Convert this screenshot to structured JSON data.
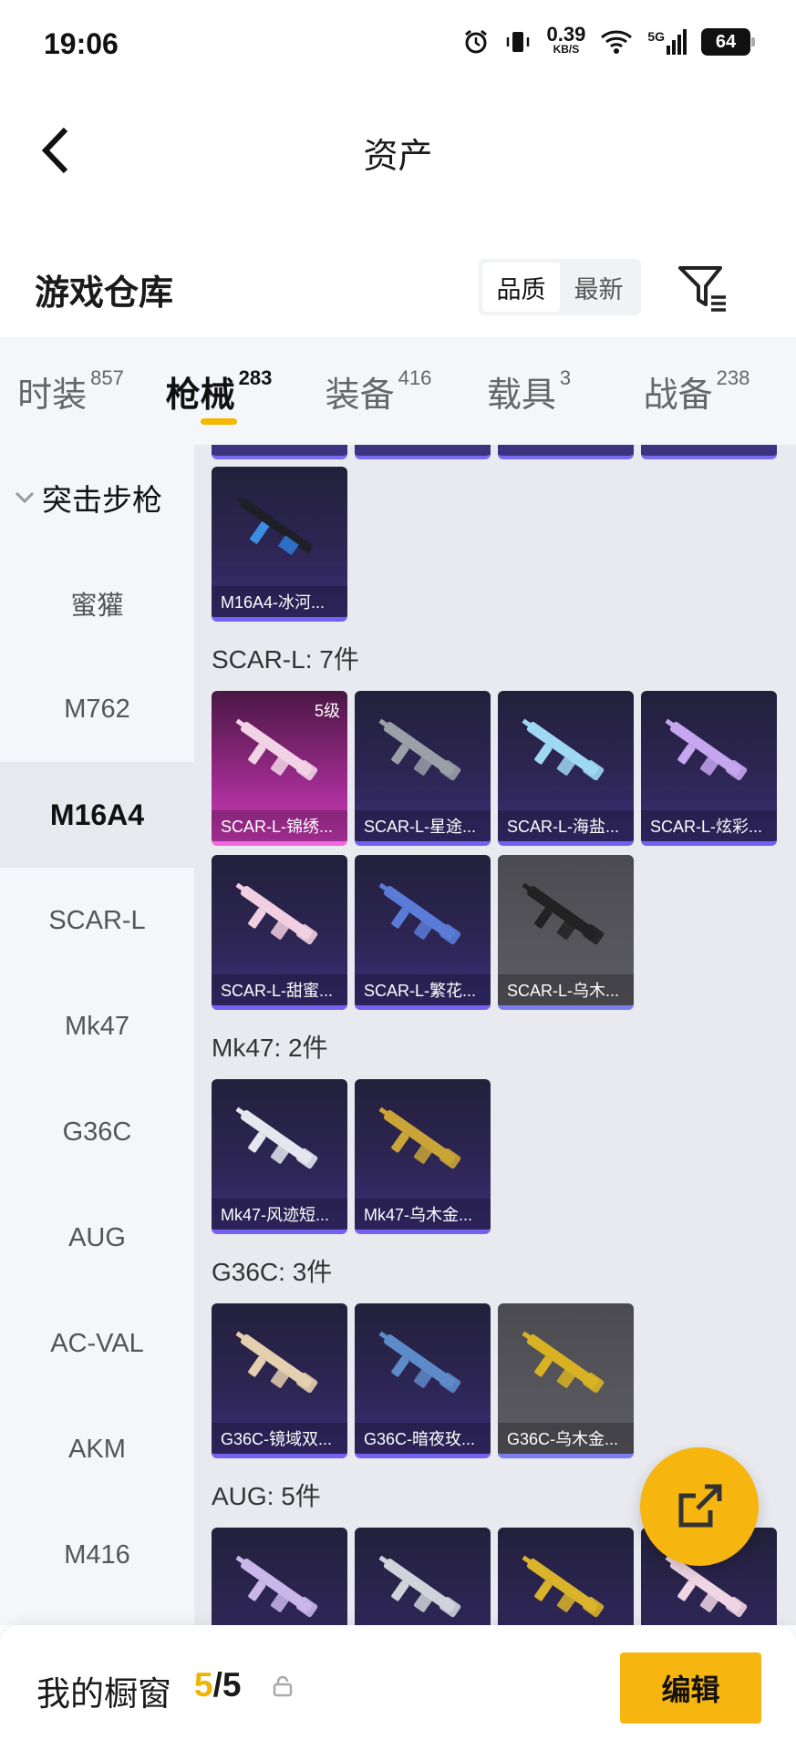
{
  "status_bar": {
    "time": "19:06",
    "net_speed": "0.39",
    "net_unit": "KB/S",
    "network": "5G",
    "battery": "64"
  },
  "header": {
    "title": "资产",
    "back_icon": "chevron-left-icon"
  },
  "warehouse": {
    "title": "游戏仓库",
    "sort": [
      "品质",
      "最新"
    ],
    "active_sort": "品质",
    "filter_icon": "filter-icon"
  },
  "tabs": [
    {
      "label": "时装",
      "count": "857"
    },
    {
      "label": "枪械",
      "count": "283",
      "active": true
    },
    {
      "label": "装备",
      "count": "416"
    },
    {
      "label": "载具",
      "count": "3"
    },
    {
      "label": "战备",
      "count": "238"
    }
  ],
  "sidebar": {
    "group": "突击步枪",
    "items": [
      "蜜獾",
      "M762",
      "M16A4",
      "SCAR-L",
      "Mk47",
      "G36C",
      "AUG",
      "AC-VAL",
      "AKM",
      "M416"
    ],
    "active": "M16A4"
  },
  "content": {
    "m16a4_items": [
      {
        "name": "M16A4-冰河..."
      }
    ],
    "groups": [
      {
        "label": "SCAR-L: 7件",
        "items": [
          {
            "name": "SCAR-L-锦绣...",
            "level": "5级",
            "style": "pink",
            "gun": "#f2d3e6"
          },
          {
            "name": "SCAR-L-星途...",
            "style": "purple",
            "gun": "#9aa0a8"
          },
          {
            "name": "SCAR-L-海盐...",
            "style": "purple",
            "gun": "#9fd8f2"
          },
          {
            "name": "SCAR-L-炫彩...",
            "style": "purple",
            "gun": "#c6a6ef"
          },
          {
            "name": "SCAR-L-甜蜜...",
            "style": "purple",
            "gun": "#f1cfe1"
          },
          {
            "name": "SCAR-L-繁花...",
            "style": "purple",
            "gun": "#5a7bd8"
          },
          {
            "name": "SCAR-L-乌木...",
            "style": "grey",
            "gun": "#222222"
          }
        ]
      },
      {
        "label": "Mk47: 2件",
        "items": [
          {
            "name": "Mk47-风迹短...",
            "style": "purple",
            "gun": "#e6e6ef"
          },
          {
            "name": "Mk47-乌木金...",
            "style": "purple",
            "gun": "#caa437"
          }
        ]
      },
      {
        "label": "G36C: 3件",
        "items": [
          {
            "name": "G36C-镜域双...",
            "style": "purple",
            "gun": "#e4cfae"
          },
          {
            "name": "G36C-暗夜玫...",
            "style": "purple",
            "gun": "#5d8ac9"
          },
          {
            "name": "G36C-乌木金...",
            "style": "grey",
            "gun": "#d8b223"
          }
        ]
      },
      {
        "label": "AUG: 5件",
        "items": [
          {
            "name": "",
            "style": "purple",
            "gun": "#c9b7e9"
          },
          {
            "name": "",
            "style": "purple",
            "gun": "#cfd3da"
          },
          {
            "name": "",
            "style": "purple",
            "gun": "#d9b42a"
          },
          {
            "name": "",
            "style": "purple",
            "gun": "#f0d6e4"
          }
        ]
      }
    ]
  },
  "fab_icon": "external-link-icon",
  "bottom": {
    "label": "我的橱窗",
    "current": "5",
    "total": "/5",
    "lock_icon": "lock-icon",
    "edit": "编辑"
  }
}
